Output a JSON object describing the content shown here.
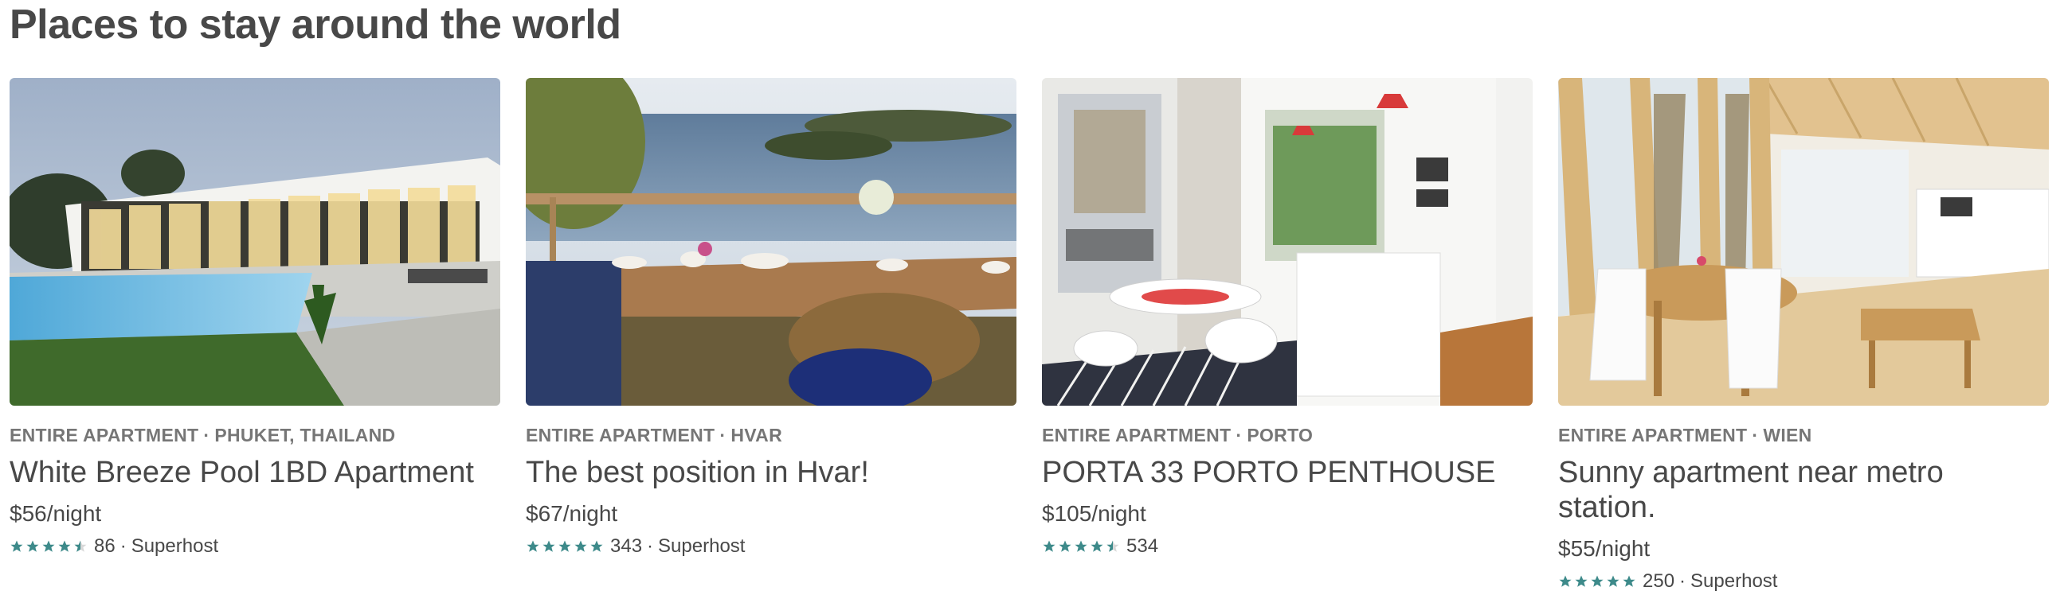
{
  "section": {
    "title": "Places to stay around the world"
  },
  "colors": {
    "star": "#3d8a8a",
    "text": "#484848",
    "muted": "#767676"
  },
  "listings": [
    {
      "type": "ENTIRE APARTMENT",
      "location": "PHUKET, THAILAND",
      "title": "White Breeze Pool 1BD Apartment",
      "price": "$56/night",
      "rating": 4.5,
      "reviews": "86",
      "badge": "Superhost"
    },
    {
      "type": "ENTIRE APARTMENT",
      "location": "HVAR",
      "title": "The best position in Hvar!",
      "price": "$67/night",
      "rating": 5,
      "reviews": "343",
      "badge": "Superhost"
    },
    {
      "type": "ENTIRE APARTMENT",
      "location": "PORTO",
      "title": "PORTA 33 PORTO PENTHOUSE",
      "price": "$105/night",
      "rating": 4.5,
      "reviews": "534",
      "badge": ""
    },
    {
      "type": "ENTIRE APARTMENT",
      "location": "WIEN",
      "title": "Sunny apartment near metro station.",
      "price": "$55/night",
      "rating": 5,
      "reviews": "250",
      "badge": "Superhost"
    }
  ]
}
